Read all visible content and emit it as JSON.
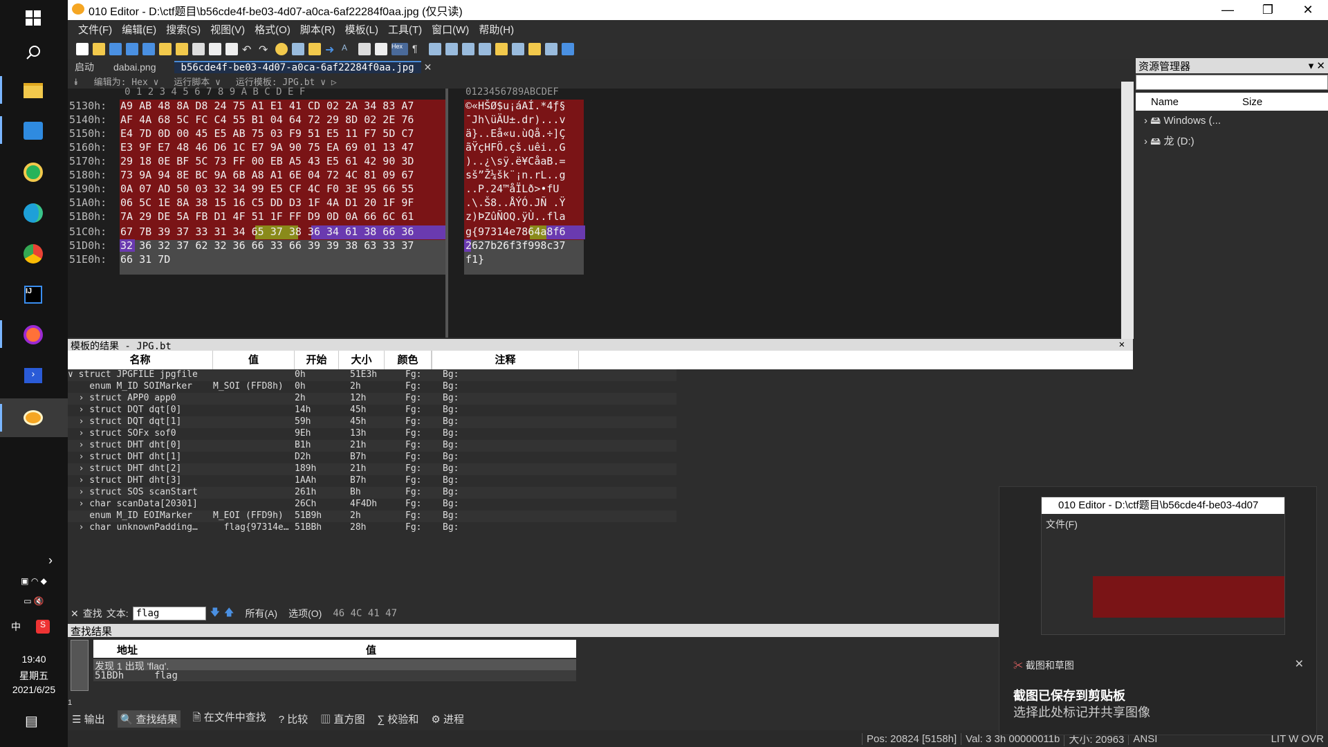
{
  "taskbar": {
    "time": "19:40",
    "weekday": "星期五",
    "date": "2021/6/25",
    "ime": "中"
  },
  "title": "010 Editor - D:\\ctf题目\\b56cde4f-be03-4d07-a0ca-6af22284f0aa.jpg  (仅只读)",
  "menu": [
    "文件(F)",
    "编辑(E)",
    "搜索(S)",
    "视图(V)",
    "格式(O)",
    "脚本(R)",
    "模板(L)",
    "工具(T)",
    "窗口(W)",
    "帮助(H)"
  ],
  "tabs": [
    "启动",
    "dabai.png",
    "b56cde4f-be03-4d07-a0ca-6af22284f0aa.jpg"
  ],
  "hex_header": {
    "edit_as": "编辑为: Hex ∨",
    "run_script": "运行脚本 ∨",
    "run_template": "运行模板: JPG.bt ∨ ▷"
  },
  "hex_cols": "0  1  2  3  4  5  6  7  8  9  A  B  C  D  E  F",
  "ascii_cols": "0123456789ABCDEF",
  "rows": [
    {
      "addr": "5130h:",
      "hex": "A9 AB 48 8A D8 24 75 A1 E1 41 CD 02 2A 34 83 A7",
      "asc": "©«HŠØ$u¡áAÍ.*4ƒ§"
    },
    {
      "addr": "5140h:",
      "hex": "AF 4A 68 5C FC C4 55 B1 04 64 72 29 8D 02 2E 76",
      "asc": "¯Jh\\üÄU±.dr)...v"
    },
    {
      "addr": "5150h:",
      "hex": "E4 7D 0D 00 45 E5 AB 75 03 F9 51 E5 11 F7 5D C7",
      "asc": "ä}..Eå«u.ùQå.÷]Ç"
    },
    {
      "addr": "5160h:",
      "hex": "E3 9F E7 48 46 D6 1C E7 9A 90 75 EA 69 01 13 47",
      "asc": "ãŸçHFÖ.çš.uêi..G"
    },
    {
      "addr": "5170h:",
      "hex": "29 18 0E BF 5C 73 FF 00 EB A5 43 E5 61 42 90 3D",
      "asc": ")..¿\\sÿ.ë¥CåaB.="
    },
    {
      "addr": "5180h:",
      "hex": "73 9A 94 8E BC 9A 6B A8 A1 6E 04 72 4C 81 09 67",
      "asc": "sš”Ž¼šk¨¡n.rL..g"
    },
    {
      "addr": "5190h:",
      "hex": "0A 07 AD 50 03 32 34 99 E5 CF 4C F0 3E 95 66 55",
      "asc": "..­P.24™åÏLð>•fU"
    },
    {
      "addr": "51A0h:",
      "hex": "06 5C 1E 8A 38 15 16 C5 DD D3 1F 4A D1 20 1F 9F",
      "asc": ".\\.Š8..ÅÝÓ.JÑ .Ÿ"
    },
    {
      "addr": "51B0h:",
      "hex": "7A 29 DE 5A FB D1 4F 51 1F FF D9 0D 0A 66 6C 61",
      "asc": "z)ÞZûÑOQ.ÿÙ..fla"
    },
    {
      "addr": "51C0h:",
      "hex": "67 7B 39 37 33 31 34 65 37 38 36 34 61 38 66 36",
      "asc": "g{97314e7864a8f6"
    },
    {
      "addr": "51D0h:",
      "hex": "32 36 32 37 62 32 36 66 33 66 39 39 38 63 33 37",
      "asc": "2627b26f3f998c37"
    },
    {
      "addr": "51E0h:",
      "hex": "66 31 7D",
      "asc": "f1}"
    }
  ],
  "template": {
    "title": "模板的结果 - JPG.bt",
    "headers": [
      "名称",
      "值",
      "开始",
      "大小",
      "颜色",
      "",
      "注释"
    ],
    "rows": [
      [
        "∨ struct JPGFILE jpgfile",
        "",
        "0h",
        "51E3h",
        "Fg:",
        "Bg:"
      ],
      [
        "    enum M_ID SOIMarker",
        "M_SOI (FFD8h)",
        "0h",
        "2h",
        "Fg:",
        "Bg:"
      ],
      [
        "  › struct APP0 app0",
        "",
        "2h",
        "12h",
        "Fg:",
        "Bg:"
      ],
      [
        "  › struct DQT dqt[0]",
        "",
        "14h",
        "45h",
        "Fg:",
        "Bg:"
      ],
      [
        "  › struct DQT dqt[1]",
        "",
        "59h",
        "45h",
        "Fg:",
        "Bg:"
      ],
      [
        "  › struct SOFx sof0",
        "",
        "9Eh",
        "13h",
        "Fg:",
        "Bg:"
      ],
      [
        "  › struct DHT dht[0]",
        "",
        "B1h",
        "21h",
        "Fg:",
        "Bg:"
      ],
      [
        "  › struct DHT dht[1]",
        "",
        "D2h",
        "B7h",
        "Fg:",
        "Bg:"
      ],
      [
        "  › struct DHT dht[2]",
        "",
        "189h",
        "21h",
        "Fg:",
        "Bg:"
      ],
      [
        "  › struct DHT dht[3]",
        "",
        "1AAh",
        "B7h",
        "Fg:",
        "Bg:"
      ],
      [
        "  › struct SOS scanStart",
        "",
        "261h",
        "Bh",
        "Fg:",
        "Bg:"
      ],
      [
        "  › char scanData[20301]",
        "",
        "26Ch",
        "4F4Dh",
        "Fg:",
        "Bg:"
      ],
      [
        "    enum M_ID EOIMarker",
        "M_EOI (FFD9h)",
        "51B9h",
        "2h",
        "Fg:",
        "Bg:"
      ],
      [
        "  › char unknownPadding…",
        "  flag{97314e…",
        "51BBh",
        "28h",
        "Fg:",
        "Bg:"
      ]
    ]
  },
  "find": {
    "close": "✕",
    "label": "查找",
    "text_label": "文本:",
    "value": "flag",
    "scope": "所有(A)",
    "options": "选项(O)",
    "hex": "46 4C 41 47"
  },
  "find_results": {
    "title": "查找结果",
    "addr_hdr": "地址",
    "val_hdr": "值",
    "summary": "发现 1 出现 'flag'.",
    "addr": "51BDh",
    "val": "flag",
    "count": "1"
  },
  "bottom_tabs": [
    "输出",
    "查找结果",
    "在文件中查找",
    "比较",
    "直方图",
    "校验和",
    "进程"
  ],
  "status": {
    "pos": "Pos: 20824 [5158h]",
    "val": "Val: 3 3h 00000011b",
    "size": "大小: 20963",
    "enc": "ANSI",
    "modes": "LIT  W  OVR"
  },
  "resource": {
    "title": "资源管理器",
    "name_hdr": "Name",
    "size_hdr": "Size",
    "items": [
      "Windows (...",
      "龙 (D:)"
    ]
  },
  "notification": {
    "app": "截图和草图",
    "title": "截图已保存到剪贴板",
    "body": "选择此处标记并共享图像",
    "thumb_title": "010 Editor - D:\\ctf题目\\b56cde4f-be03-4d07"
  }
}
